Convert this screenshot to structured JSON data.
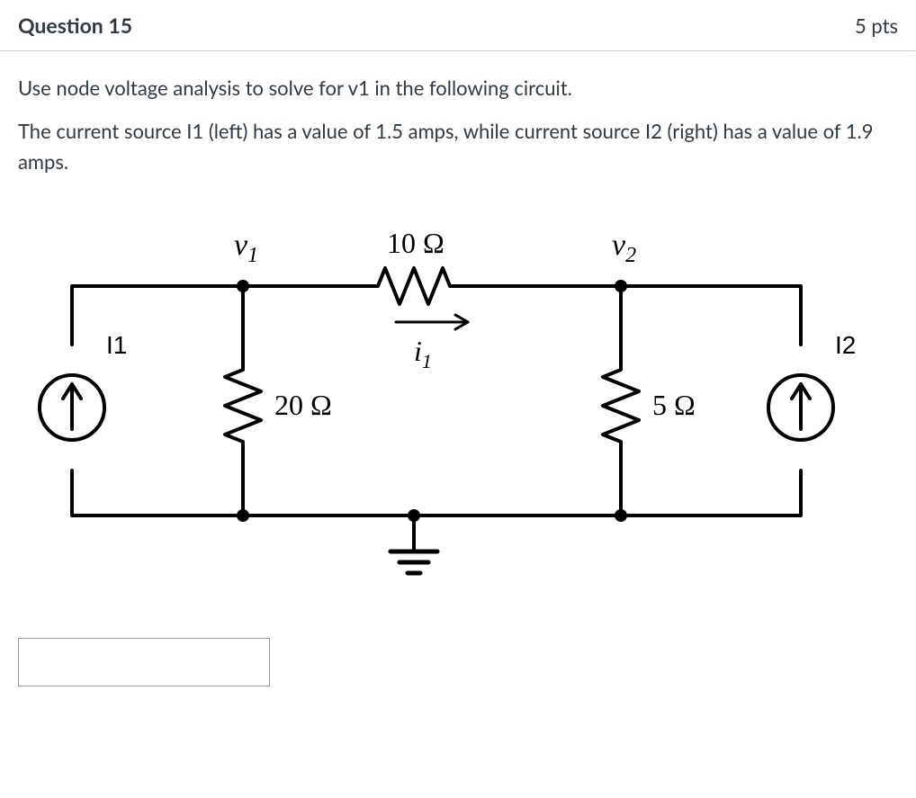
{
  "header": {
    "title": "Question 15",
    "points": "5 pts"
  },
  "prompt": {
    "line1": "Use node voltage analysis to solve for v1 in the following circuit.",
    "line2": "The current source I1 (left) has a value of 1.5 amps, while current source I2 (right) has a value of 1.9 amps."
  },
  "circuit": {
    "nodes": {
      "v1": "v",
      "v1_sub": "1",
      "v2": "v",
      "v2_sub": "2"
    },
    "components": {
      "R_top": "10 Ω",
      "R_left": "20 Ω",
      "R_right": "5 Ω",
      "I1_label": "I1",
      "I2_label": "I2",
      "i1_flow": "i",
      "i1_flow_sub": "1"
    }
  },
  "answer": {
    "value": ""
  }
}
